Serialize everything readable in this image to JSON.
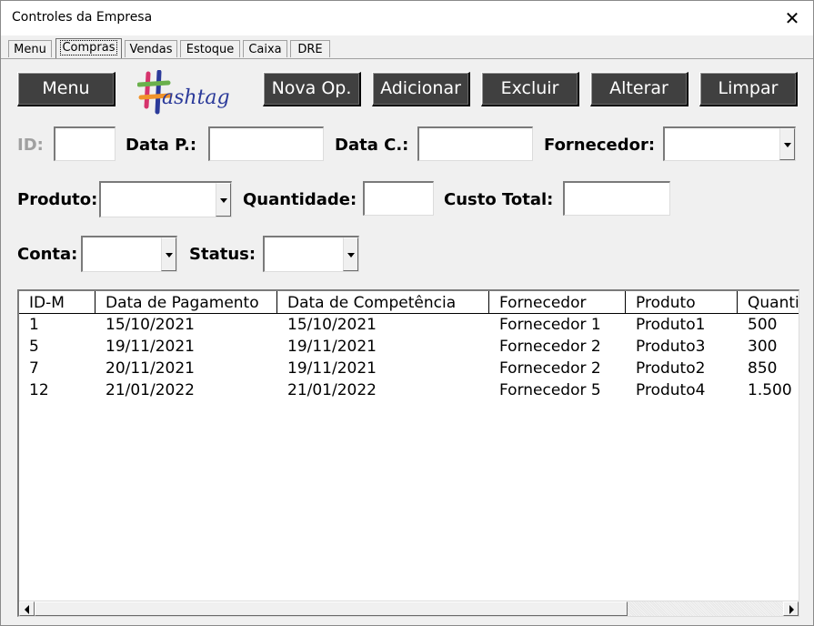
{
  "window": {
    "title": "Controles da Empresa"
  },
  "tabs": [
    {
      "label": "Menu"
    },
    {
      "label": "Compras"
    },
    {
      "label": "Vendas"
    },
    {
      "label": "Estoque"
    },
    {
      "label": "Caixa"
    },
    {
      "label": "DRE"
    }
  ],
  "toolbar": {
    "menu": "Menu",
    "logo": "ashtag",
    "nova_op": "Nova Op.",
    "adicionar": "Adicionar",
    "excluir": "Excluir",
    "alterar": "Alterar",
    "limpar": "Limpar"
  },
  "form": {
    "id_label": "ID:",
    "data_p_label": "Data P.:",
    "data_c_label": "Data C.:",
    "fornecedor_label": "Fornecedor:",
    "produto_label": "Produto:",
    "quantidade_label": "Quantidade:",
    "custo_label": "Custo Total:",
    "conta_label": "Conta:",
    "status_label": "Status:"
  },
  "table": {
    "headers": [
      "ID-M",
      "Data de Pagamento",
      "Data de Competência",
      "Fornecedor",
      "Produto",
      "Quanti"
    ],
    "rows": [
      [
        "1",
        "15/10/2021",
        "15/10/2021",
        "Fornecedor 1",
        "Produto1",
        "500"
      ],
      [
        "5",
        "19/11/2021",
        "19/11/2021",
        "Fornecedor 2",
        "Produto3",
        "300"
      ],
      [
        "7",
        "20/11/2021",
        "19/11/2021",
        "Fornecedor 2",
        "Produto2",
        "850"
      ],
      [
        "12",
        "21/01/2022",
        "21/01/2022",
        "Fornecedor 5",
        "Produto4",
        "1.500"
      ]
    ]
  },
  "colors": {
    "button_bg": "#404040",
    "logo_blue": "#2b3a9a",
    "logo_pink": "#d6336c",
    "logo_green": "#6ab04c",
    "logo_orange": "#f0932b"
  }
}
